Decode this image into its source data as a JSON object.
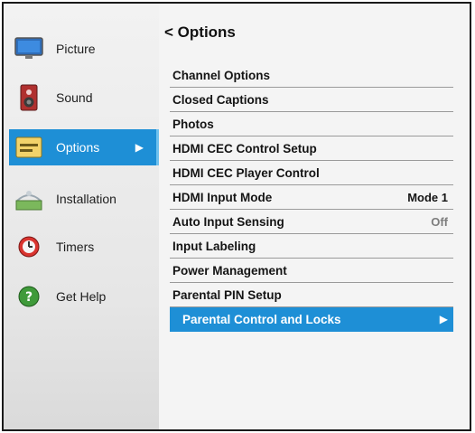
{
  "sidebar": {
    "items": [
      {
        "label": "Picture",
        "icon": "monitor-icon"
      },
      {
        "label": "Sound",
        "icon": "speaker-icon"
      },
      {
        "label": "Options",
        "icon": "options-icon",
        "selected": true,
        "arrow": "▶"
      },
      {
        "label": "Installation",
        "icon": "installation-icon"
      },
      {
        "label": "Timers",
        "icon": "timer-icon"
      },
      {
        "label": "Get Help",
        "icon": "help-icon"
      }
    ]
  },
  "panel": {
    "back_glyph": "<",
    "title": "Options",
    "items": [
      {
        "label": "Channel Options"
      },
      {
        "label": "Closed Captions"
      },
      {
        "label": "Photos"
      },
      {
        "label": "HDMI CEC Control Setup"
      },
      {
        "label": "HDMI CEC Player Control"
      },
      {
        "label": "HDMI Input Mode",
        "value": "Mode 1"
      },
      {
        "label": "Auto Input Sensing",
        "value": "Off"
      },
      {
        "label": "Input Labeling"
      },
      {
        "label": "Power Management"
      },
      {
        "label": "Parental PIN Setup"
      },
      {
        "label": "Parental Control and Locks",
        "selected": true,
        "arrow": "▶"
      }
    ]
  },
  "colors": {
    "accent": "#1e8fd6",
    "background": "#f4f4f4",
    "text": "#141414",
    "muted": "#7d7d7d"
  }
}
